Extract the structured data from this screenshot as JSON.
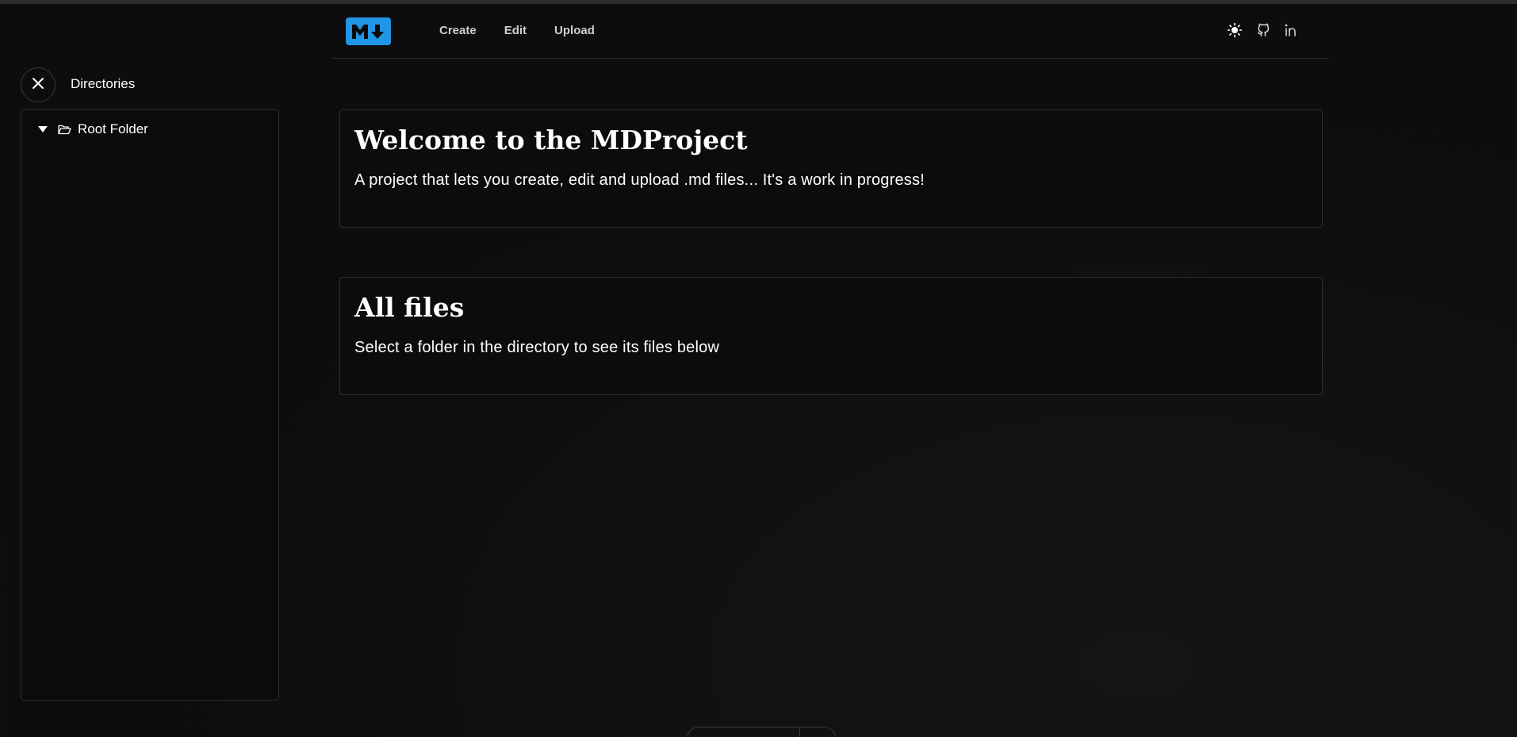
{
  "header": {
    "logo_text": "M↓",
    "nav": [
      {
        "label": "Create"
      },
      {
        "label": "Edit"
      },
      {
        "label": "Upload"
      }
    ],
    "icons": [
      "sun-icon",
      "github-icon",
      "linkedin-icon"
    ]
  },
  "sidebar": {
    "title": "Directories",
    "close_icon": "close-icon",
    "tree": [
      {
        "label": "Root Folder",
        "expanded": true,
        "icon": "folder-open-icon"
      }
    ]
  },
  "main": {
    "welcome": {
      "title": "Welcome to the MDProject",
      "text": "A project that lets you create, edit and upload .md files... It's a work in progress!"
    },
    "files": {
      "title": "All files",
      "text": "Select a folder in the directory to see its files below"
    }
  },
  "colors": {
    "background": "#0d0d0e",
    "accent": "#2196e6",
    "border": "#2e2e31"
  }
}
